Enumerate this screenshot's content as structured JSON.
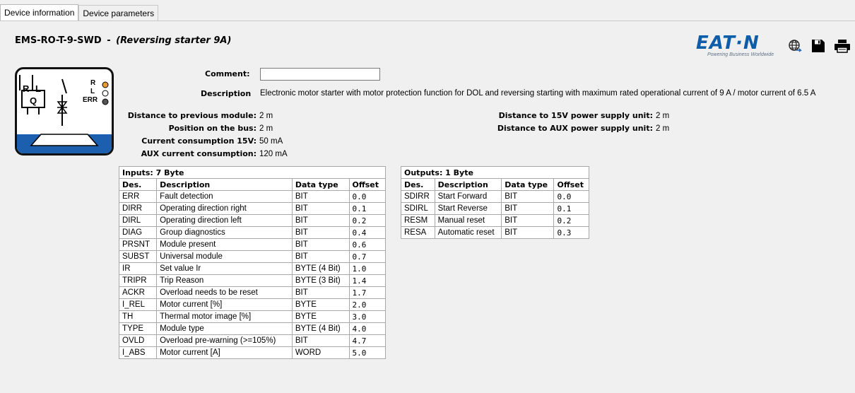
{
  "tabs": [
    {
      "label": "Device information",
      "active": true
    },
    {
      "label": "Device parameters",
      "active": false
    }
  ],
  "device": {
    "model": "EMS-RO-T-9-SWD",
    "separator": "-",
    "name": "(Reversing starter 9A)"
  },
  "logo": {
    "word": "EAT·N",
    "tagline": "Powering Business Worldwide",
    "brand_color": "#0e5da8"
  },
  "toolbar_icons": [
    "globe-icon",
    "save-icon",
    "print-icon"
  ],
  "schematic": {
    "r_label": "R",
    "l_label": "L",
    "q_label": "Q",
    "led_r": "R",
    "led_l": "L",
    "led_err": "ERR"
  },
  "properties": {
    "comment_label": "Comment:",
    "comment_value": "",
    "description_label": "Description",
    "description_value": "Electronic motor starter with motor protection function for DOL and reversing starting with maximum rated operational current of 9 A / motor current of 6.5 A",
    "distance_prev_label": "Distance to previous module:",
    "distance_prev_value": "2 m",
    "position_label": "Position on the bus:",
    "position_value": "2 m",
    "current15_label": "Current consumption 15V:",
    "current15_value": "50 mA",
    "aux_label": "AUX current consumption:",
    "aux_value": "120 mA",
    "dist15_label": "Distance to 15V power supply unit:",
    "dist15_value": "2 m",
    "distaux_label": "Distance to AUX power supply unit:",
    "distaux_value": "2 m"
  },
  "inputs": {
    "caption": "Inputs: 7 Byte",
    "headers": [
      "Des.",
      "Description",
      "Data type",
      "Offset"
    ],
    "rows": [
      [
        "ERR",
        "Fault detection",
        "BIT",
        "0.0"
      ],
      [
        "DIRR",
        "Operating direction right",
        "BIT",
        "0.1"
      ],
      [
        "DIRL",
        "Operating direction left",
        "BIT",
        "0.2"
      ],
      [
        "DIAG",
        "Group diagnostics",
        "BIT",
        "0.4"
      ],
      [
        "PRSNT",
        "Module present",
        "BIT",
        "0.6"
      ],
      [
        "SUBST",
        "Universal module",
        "BIT",
        "0.7"
      ],
      [
        "IR",
        "Set value Ir",
        "BYTE (4 Bit)",
        "1.0"
      ],
      [
        "TRIPR",
        "Trip Reason",
        "BYTE (3 Bit)",
        "1.4"
      ],
      [
        "ACKR",
        "Overload needs to be reset",
        "BIT",
        "1.7"
      ],
      [
        "I_REL",
        "Motor current [%]",
        "BYTE",
        "2.0"
      ],
      [
        "TH",
        "Thermal motor image [%]",
        "BYTE",
        "3.0"
      ],
      [
        "TYPE",
        "Module type",
        "BYTE (4 Bit)",
        "4.0"
      ],
      [
        "OVLD",
        "Overload pre-warning (>=105%)",
        "BIT",
        "4.7"
      ],
      [
        "I_ABS",
        "Motor current [A]",
        "WORD",
        "5.0"
      ]
    ]
  },
  "outputs": {
    "caption": "Outputs: 1 Byte",
    "headers": [
      "Des.",
      "Description",
      "Data type",
      "Offset"
    ],
    "rows": [
      [
        "SDIRR",
        "Start Forward",
        "BIT",
        "0.0"
      ],
      [
        "SDIRL",
        "Start Reverse",
        "BIT",
        "0.1"
      ],
      [
        "RESM",
        "Manual reset",
        "BIT",
        "0.2"
      ],
      [
        "RESA",
        "Automatic reset",
        "BIT",
        "0.3"
      ]
    ]
  }
}
